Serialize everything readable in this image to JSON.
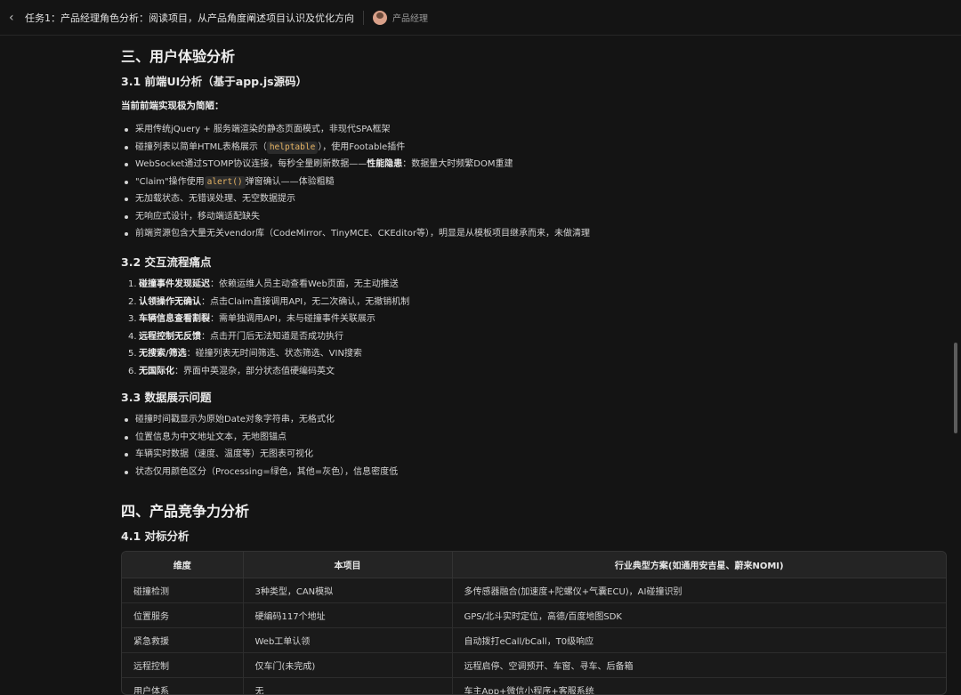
{
  "header": {
    "task_title": "任务1：产品经理角色分析：阅读项目，从产品角度阐述项目认识及优化方向",
    "role": "产品经理"
  },
  "section3": {
    "title": "三、用户体验分析",
    "s31": {
      "title": "3.1 前端UI分析（基于app.js源码）",
      "lead": "当前前端实现极为简陋：",
      "items": [
        {
          "pre": "采用传统jQuery + 服务端渲染的静态页面模式，非现代SPA框架"
        },
        {
          "pre": "碰撞列表以简单HTML表格展示（",
          "code": "helptable",
          "post": "），使用Footable插件"
        },
        {
          "pre": "WebSocket通过STOMP协议连接，每秒全量刷新数据——",
          "bold": "性能隐患",
          "post": "：数据量大时频繁DOM重建"
        },
        {
          "pre": "\"Claim\"操作使用",
          "code": "alert()",
          "post": "弹窗确认——体验粗糙"
        },
        {
          "pre": "无加载状态、无错误处理、无空数据提示"
        },
        {
          "pre": "无响应式设计，移动端适配缺失"
        },
        {
          "pre": "前端资源包含大量无关vendor库（CodeMirror、TinyMCE、CKEditor等），明显是从模板项目继承而来，未做清理"
        }
      ]
    },
    "s32": {
      "title": "3.2 交互流程痛点",
      "items": [
        {
          "num": "1.",
          "bold": "碰撞事件发现延迟",
          "text": "：依赖运维人员主动查看Web页面，无主动推送"
        },
        {
          "num": "2.",
          "bold": "认领操作无确认",
          "text": "：点击Claim直接调用API，无二次确认，无撤销机制"
        },
        {
          "num": "3.",
          "bold": "车辆信息查看割裂",
          "text": "：需单独调用API，未与碰撞事件关联展示"
        },
        {
          "num": "4.",
          "bold": "远程控制无反馈",
          "text": "：点击开门后无法知道是否成功执行"
        },
        {
          "num": "5.",
          "bold": "无搜索/筛选",
          "text": "：碰撞列表无时间筛选、状态筛选、VIN搜索"
        },
        {
          "num": "6.",
          "bold": "无国际化",
          "text": "：界面中英混杂，部分状态值硬编码英文"
        }
      ]
    },
    "s33": {
      "title": "3.3 数据展示问题",
      "items": [
        "碰撞时间戳显示为原始Date对象字符串，无格式化",
        "位置信息为中文地址文本，无地图锚点",
        "车辆实时数据（速度、温度等）无图表可视化",
        "状态仅用颜色区分（Processing=绿色，其他=灰色），信息密度低"
      ]
    }
  },
  "section4": {
    "title": "四、产品竞争力分析",
    "s41": {
      "title": "4.1 对标分析",
      "headers": [
        "维度",
        "本项目",
        "行业典型方案(如通用安吉星、蔚来NOMI)"
      ],
      "rows": [
        [
          "碰撞检测",
          "3种类型，CAN模拟",
          "多传感器融合(加速度+陀螺仪+气囊ECU)，AI碰撞识别"
        ],
        [
          "位置服务",
          "硬编码117个地址",
          "GPS/北斗实时定位，高德/百度地图SDK"
        ],
        [
          "紧急救援",
          "Web工单认领",
          "自动拨打eCall/bCall，T0级响应"
        ],
        [
          "远程控制",
          "仅车门(未完成)",
          "远程启停、空调预开、车窗、寻车、后备箱"
        ],
        [
          "用户体系",
          "无",
          "车主App+微信小程序+客服系统"
        ]
      ]
    }
  }
}
